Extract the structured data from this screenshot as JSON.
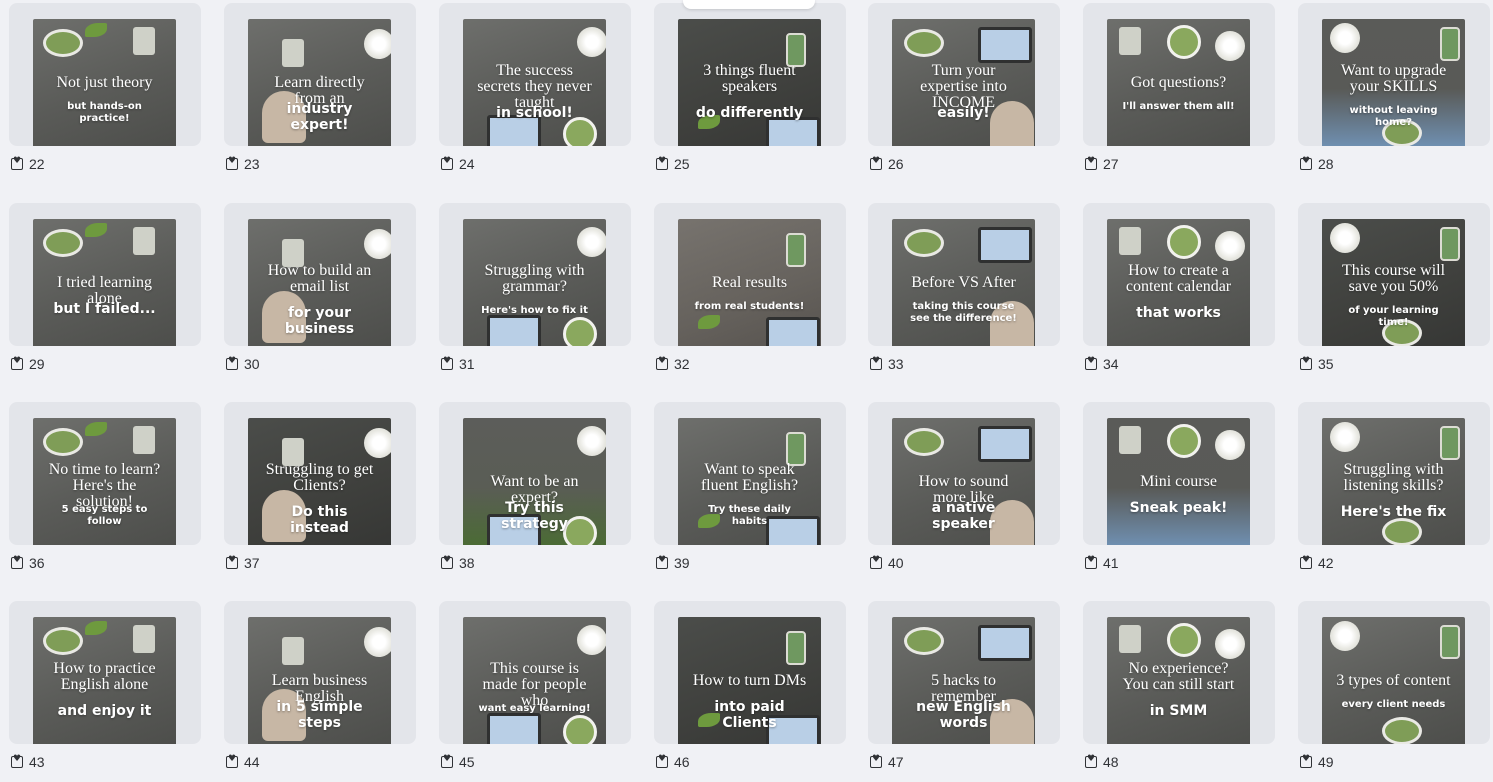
{
  "tooltip": "",
  "templates": [
    {
      "number": "22",
      "line1": "Not just theory",
      "line2": "but hands-on practice!",
      "theme": "default"
    },
    {
      "number": "23",
      "line1": "Learn directly from an",
      "line2": "industry expert!",
      "theme": "default"
    },
    {
      "number": "24",
      "line1": "The success secrets they never taught",
      "line2": "in school!",
      "theme": "default"
    },
    {
      "number": "25",
      "line1": "3 things fluent speakers",
      "line2": "do differently",
      "theme": "dark"
    },
    {
      "number": "26",
      "line1": "Turn your expertise into INCOME",
      "line2": "easily!",
      "theme": "default"
    },
    {
      "number": "27",
      "line1": "Got questions?",
      "line2": "I'll answer them all!",
      "theme": "default"
    },
    {
      "number": "28",
      "line1": "Want to upgrade your SKILLS",
      "line2": "without leaving home?",
      "theme": "sky"
    },
    {
      "number": "29",
      "line1": "I tried learning alone",
      "line2": "but I failed...",
      "theme": "default"
    },
    {
      "number": "30",
      "line1": "How to build an email list",
      "line2": "for your business",
      "theme": "default"
    },
    {
      "number": "31",
      "line1": "Struggling with grammar?",
      "line2": "Here's how to fix it",
      "theme": "default"
    },
    {
      "number": "32",
      "line1": "Real results",
      "line2": "from real students!",
      "theme": "warm"
    },
    {
      "number": "33",
      "line1": "Before VS After",
      "line2": "taking this course see the difference!",
      "theme": "default"
    },
    {
      "number": "34",
      "line1": "How to create a content calendar",
      "line2": "that works",
      "theme": "default"
    },
    {
      "number": "35",
      "line1": "This course will save you 50%",
      "line2": "of your learning time!",
      "theme": "dark"
    },
    {
      "number": "36",
      "line1": "No time to learn? Here's the solution!",
      "line2": "5 easy steps to follow",
      "theme": "default"
    },
    {
      "number": "37",
      "line1": "Struggling to get Clients?",
      "line2": "Do this instead",
      "theme": "dark"
    },
    {
      "number": "38",
      "line1": "Want to be an expert?",
      "line2": "Try this strategy",
      "theme": "green"
    },
    {
      "number": "39",
      "line1": "Want to speak fluent English?",
      "line2": "Try these daily habits",
      "theme": "default"
    },
    {
      "number": "40",
      "line1": "How to sound more like",
      "line2": "a native speaker",
      "theme": "default"
    },
    {
      "number": "41",
      "line1": "Mini course",
      "line2": "Sneak peak!",
      "theme": "sky"
    },
    {
      "number": "42",
      "line1": "Struggling with listening skills?",
      "line2": "Here's the fix",
      "theme": "default"
    },
    {
      "number": "43",
      "line1": "How to practice English alone",
      "line2": "and enjoy it",
      "theme": "default"
    },
    {
      "number": "44",
      "line1": "Learn business English",
      "line2": "in 5 simple steps",
      "theme": "default"
    },
    {
      "number": "45",
      "line1": "This course is made for people who",
      "line2": "want easy learning!",
      "theme": "default"
    },
    {
      "number": "46",
      "line1": "How to turn DMs",
      "line2": "into paid Clients",
      "theme": "dark"
    },
    {
      "number": "47",
      "line1": "5 hacks to remember",
      "line2": "new English words",
      "theme": "default"
    },
    {
      "number": "48",
      "line1": "No experience? You can still start",
      "line2": "in SMM",
      "theme": "default"
    },
    {
      "number": "49",
      "line1": "3 types of content",
      "line2": "every client needs",
      "theme": "default"
    }
  ]
}
